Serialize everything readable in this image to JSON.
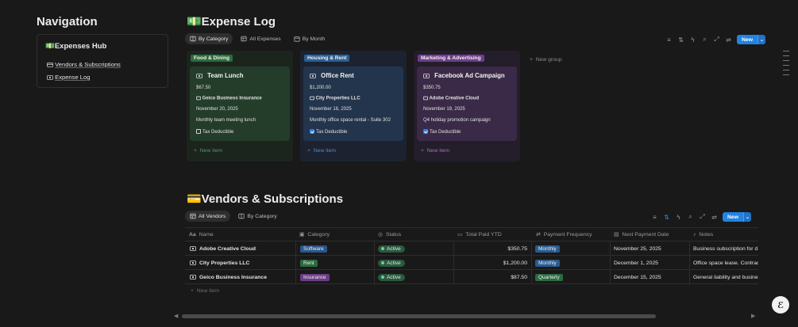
{
  "nav": {
    "title": "Navigation",
    "hub": "💵Expenses Hub",
    "links": [
      "Vendors & Subscriptions",
      "Expense Log"
    ]
  },
  "expense_log": {
    "title": "💵Expense Log",
    "tabs": [
      "By Category",
      "All Expenses",
      "By Month"
    ],
    "new_label": "New",
    "new_group": "New group",
    "columns": [
      {
        "tag": "Food & Dining",
        "card": {
          "title": "Team Lunch",
          "amount": "$67.50",
          "vendor": "Geico Business Insurance",
          "date": "November 20, 2025",
          "desc": "Monthly team meeting lunch",
          "tax_label": "Tax Deductible",
          "tax_checked": false
        },
        "new_item": "New item"
      },
      {
        "tag": "Housing & Rent",
        "card": {
          "title": "Office Rent",
          "amount": "$1,200.00",
          "vendor": "City Properties LLC",
          "date": "November 18, 2025",
          "desc": "Monthly office space rental - Suite 302",
          "tax_label": "Tax Deductible",
          "tax_checked": true
        },
        "new_item": "New item"
      },
      {
        "tag": "Marketing & Advertising",
        "card": {
          "title": "Facebook Ad Campaign",
          "amount": "$350.75",
          "vendor": "Adobe Creative Cloud",
          "date": "November 19, 2025",
          "desc": "Q4 holiday promotion campaign",
          "tax_label": "Tax Deductible",
          "tax_checked": true
        },
        "new_item": "New item"
      }
    ]
  },
  "vendors": {
    "title": "💳Vendors & Subscriptions",
    "tabs": [
      "All Vendors",
      "By Category"
    ],
    "new_label": "New",
    "headers": [
      "Name",
      "Category",
      "Status",
      "Total Paid YTD",
      "Payment Frequency",
      "Next Payment Date",
      "Notes"
    ],
    "rows": [
      {
        "name": "Adobe Creative Cloud",
        "category": "Software",
        "status": "Active",
        "total": "$350.75",
        "freq": "Monthly",
        "next": "November 25, 2025",
        "notes": "Business subscription for d"
      },
      {
        "name": "City Properties LLC",
        "category": "Rent",
        "status": "Active",
        "total": "$1,200.00",
        "freq": "Monthly",
        "next": "December 1, 2025",
        "notes": "Office space lease. Contrac"
      },
      {
        "name": "Geico Business Insurance",
        "category": "Insurance",
        "status": "Active",
        "total": "$87.50",
        "freq": "Quarterly",
        "next": "December 15, 2025",
        "notes": "General liability and busines"
      }
    ],
    "new_item": "New item"
  },
  "colors": {
    "food": "#2b6d3a",
    "housing": "#295f93",
    "marketing": "#6d3d8a",
    "software": "#29558a",
    "rent": "#2b6b3f",
    "insurance": "#6b3d85",
    "monthly": "#295b8f",
    "quarterly": "#2b6a40",
    "accent": "#2383e2"
  },
  "icons": {
    "card": "card-icon",
    "checkbox": "checkbox-icon"
  }
}
